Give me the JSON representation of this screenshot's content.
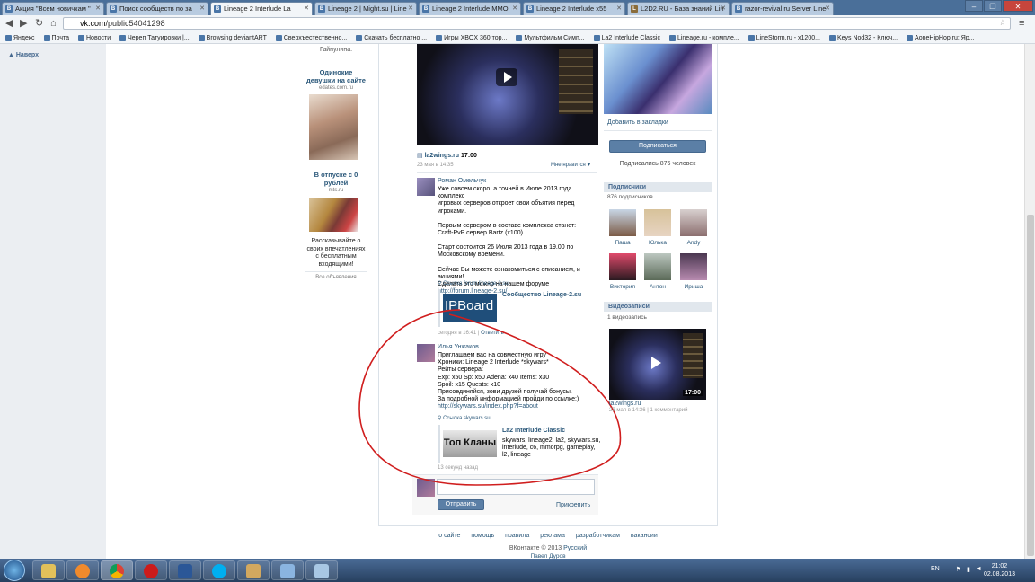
{
  "tabs": [
    {
      "label": "Акция \"Всем новичкам \"",
      "active": false
    },
    {
      "label": "Поиск сообществ по за",
      "active": false
    },
    {
      "label": "Lineage 2 Interlude La",
      "active": true
    },
    {
      "label": "Lineage 2 | Might.su | Line",
      "active": false
    },
    {
      "label": "Lineage 2 Interlude MMO",
      "active": false
    },
    {
      "label": "Lineage 2 Interlude x55",
      "active": false
    },
    {
      "label": "L2D2.RU - База знаний Lin",
      "active": false
    },
    {
      "label": "razor-revival.ru Server Line",
      "active": false
    }
  ],
  "address": {
    "host": "vk.com",
    "path": "/public54041298"
  },
  "bookmarks": [
    "Яндекс",
    "Почта",
    "Новости",
    "Череп Татуировки |...",
    "Browsing deviantART",
    "Сверхъестественно...",
    "Скачать бесплатно ...",
    "Игры XBOX 360 тор...",
    "Мультфильм Симп...",
    "La2 Interlude Classic",
    "Lineage.ru - компле...",
    "LineStorm.ru - x1200...",
    "Keys Nod32 - Ключ...",
    "AoneHipHop.ru: Яр..."
  ],
  "left_menu": {
    "up": "Наверх"
  },
  "ads": [
    {
      "name_partial": "Гайнулина.",
      "title": "Одинокие девушки на сайте",
      "site": "edates.com.ru"
    },
    {
      "title": "В отпуске с 0 рублей",
      "site": "mts.ru",
      "text": "Рассказывайте о своих впечатлениях с бесплатным входящими!"
    }
  ],
  "ads_all": "Все объявления",
  "video_post": {
    "link": "la2wings.ru",
    "time": "17:00",
    "date": "23 мая в 14:35",
    "like": "Мне нравится"
  },
  "comment1": {
    "author": "Роман Омельчук",
    "lines": [
      "Уже совсем скоро, а точней в Июле 2013 года комплекс",
      "игровых серверов откроет свои объятия перед игроками.",
      "",
      "Первым сервером в составе комплекса станет:",
      "Craft-PvP сервер Bartz (x100).",
      "",
      "Старт состоится 26 Июля 2013 года в 19.00 по",
      "Московскому времени.",
      "",
      "Сейчас Вы можете ознакомиться с описанием, и акциями!",
      "Сделать это можно на нашем форуме"
    ],
    "forum_link": "http://forum.lineage-2.su/",
    "link_label": "Ссылка forum.lineage-2.su",
    "card_title": "Сообщество Lineage-2.su",
    "card_image_text": "IPBoard",
    "date": "сегодня в 16:41",
    "reply": "Ответить"
  },
  "comment2": {
    "author": "Илья Унжаков",
    "lines": [
      "Приглашаем вас на совместную игру",
      "Хроники: Lineage 2 Interlude *skywars*",
      "Рейты сервера:",
      "Exp: x50 Sp: x50 Adena: x40 Items: x30",
      "Spoil: x15 Quests: x10",
      "Присоединяйся, зови друзей получай бонусы.",
      "За подробной информацией пройди по ссылке:)"
    ],
    "url": "http://skywars.su/index.php?f=about",
    "link_label": "Ссылка skywars.su",
    "card_title": "La2 Interlude Classic",
    "card_desc": [
      "skywars, lineage2, la2, skywars.su,",
      "interlude, c6, mmorpg, gameplay,",
      "l2, lineage"
    ],
    "card_image_text": "Топ Кланы",
    "date": "13 секунд назад"
  },
  "reply_form": {
    "send": "Отправить",
    "attach": "Прикрепить"
  },
  "sidebar": {
    "bookmark": "Добавить в закладки",
    "subscribe": "Подписаться",
    "subscribed": "Подписались 876 человек",
    "subs_header": "Подписчики",
    "subs_count": "876 подписчиков",
    "subs": [
      "Паша",
      "Юлька",
      "Andy",
      "Виктория",
      "Антон",
      "Ириша"
    ],
    "videos_header": "Видеозаписи",
    "videos_count": "1 видеозапись",
    "video_time": "17:00",
    "video_link": "la2wings.ru",
    "video_meta": "23 мая в 14:36 | 1 комментарий"
  },
  "footer": {
    "links": [
      "о сайте",
      "помощь",
      "правила",
      "реклама",
      "разработчикам",
      "вакансии"
    ],
    "copyright": "ВКонтакте © 2013",
    "lang": "Русский",
    "author": "Павел Дуров"
  },
  "taskbar": {
    "lang": "EN",
    "time": "21:02",
    "date": "02.08.2013"
  }
}
